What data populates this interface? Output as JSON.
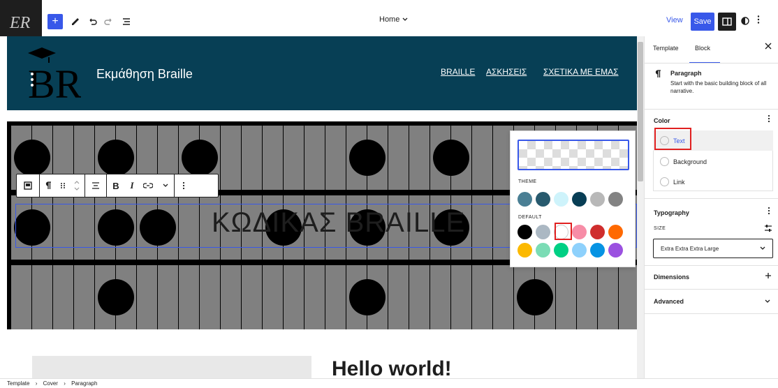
{
  "toolbar": {
    "logo_text": "ER",
    "add_label": "+",
    "document_title": "Home",
    "view_label": "View",
    "save_label": "Save"
  },
  "site": {
    "title": "Εκμάθηση Braille",
    "nav": [
      "BRAILLE",
      "ΑΣΚΗΣΕΙΣ",
      "ΣΧΕΤΙΚΑ ΜΕ ΕΜΑΣ"
    ],
    "cover_text": "ΚΩΔΙΚΑΣ BRAILLE",
    "post_title": "Hello world!"
  },
  "block_toolbar": {
    "bold_label": "B",
    "italic_label": "I"
  },
  "color_popover": {
    "theme_label": "THEME",
    "default_label": "DEFAULT",
    "theme_colors": [
      "#4a7f94",
      "#285a6e",
      "#cef3fb",
      "#083e55",
      "#b8b8b8",
      "#838383"
    ],
    "default_colors": [
      "#000000",
      "#abb8c3",
      "#ffffff",
      "#f78da7",
      "#cf2e2e",
      "#ff6900",
      "#fcb900",
      "#7bdcb5",
      "#00d084",
      "#8ed1fc",
      "#0693e3",
      "#9b51e0"
    ]
  },
  "sidebar": {
    "tabs": [
      "Template",
      "Block"
    ],
    "block_title": "Paragraph",
    "block_desc": "Start with the basic building block of all narrative.",
    "color_heading": "Color",
    "color_items": [
      "Text",
      "Background",
      "Link"
    ],
    "typography_heading": "Typography",
    "size_label": "SIZE",
    "size_value": "Extra Extra Extra Large",
    "dimensions_heading": "Dimensions",
    "advanced_heading": "Advanced"
  },
  "breadcrumb": [
    "Template",
    "Cover",
    "Paragraph"
  ]
}
